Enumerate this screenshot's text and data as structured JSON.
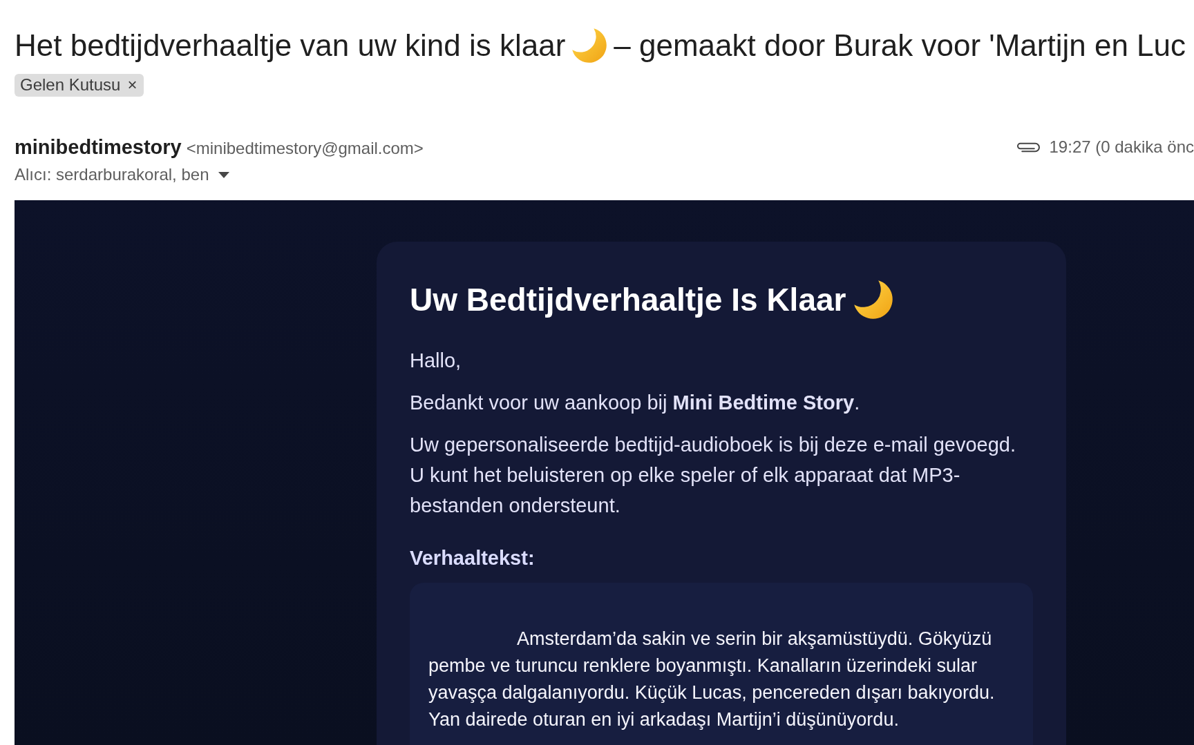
{
  "subject": {
    "parts": [
      {
        "kind": "text",
        "text": "Het bedtijdverhaaltje van uw kind is klaar"
      },
      {
        "kind": "moon"
      },
      {
        "kind": "text",
        "text": "– gemaakt door Burak voor 'Martijn en Luc"
      }
    ]
  },
  "labels": [
    {
      "text": "Gelen Kutusu",
      "remove": "×"
    }
  ],
  "sender": {
    "name": "minibedtimestory",
    "email": "<minibedtimestory@gmail.com>"
  },
  "has_attachment": true,
  "time": "19:27 (0 dakika önc",
  "recipients": "Alıcı: serdarburakoral, ben",
  "message": {
    "heading": {
      "parts": [
        {
          "kind": "text",
          "text": "Uw Bedtijdverhaaltje Is Klaar"
        },
        {
          "kind": "moon"
        }
      ]
    },
    "paragraphs": [
      "Hallo,",
      "Bedankt voor uw aankoop bij **Mini Bedtime Story**.",
      "Uw gepersonaliseerde bedtijd-audioboek is bij deze e-mail gevoegd. U kunt het beluisteren op elke speler of elk apparaat dat MP3-bestanden ondersteunt."
    ],
    "story_label": "Verhaaltekst:",
    "story_text": "Amsterdam’da sakin ve serin bir akşamüstüydü. Gökyüzü pembe ve turuncu renklere boyanmıştı. Kanalların üzerindeki sular yavaşça dalgalanıyordu. Küçük Lucas, pencereden dışarı bakıyordu. Yan dairede oturan en iyi arkadaşı Martijn’i düşünüyordu."
  }
}
